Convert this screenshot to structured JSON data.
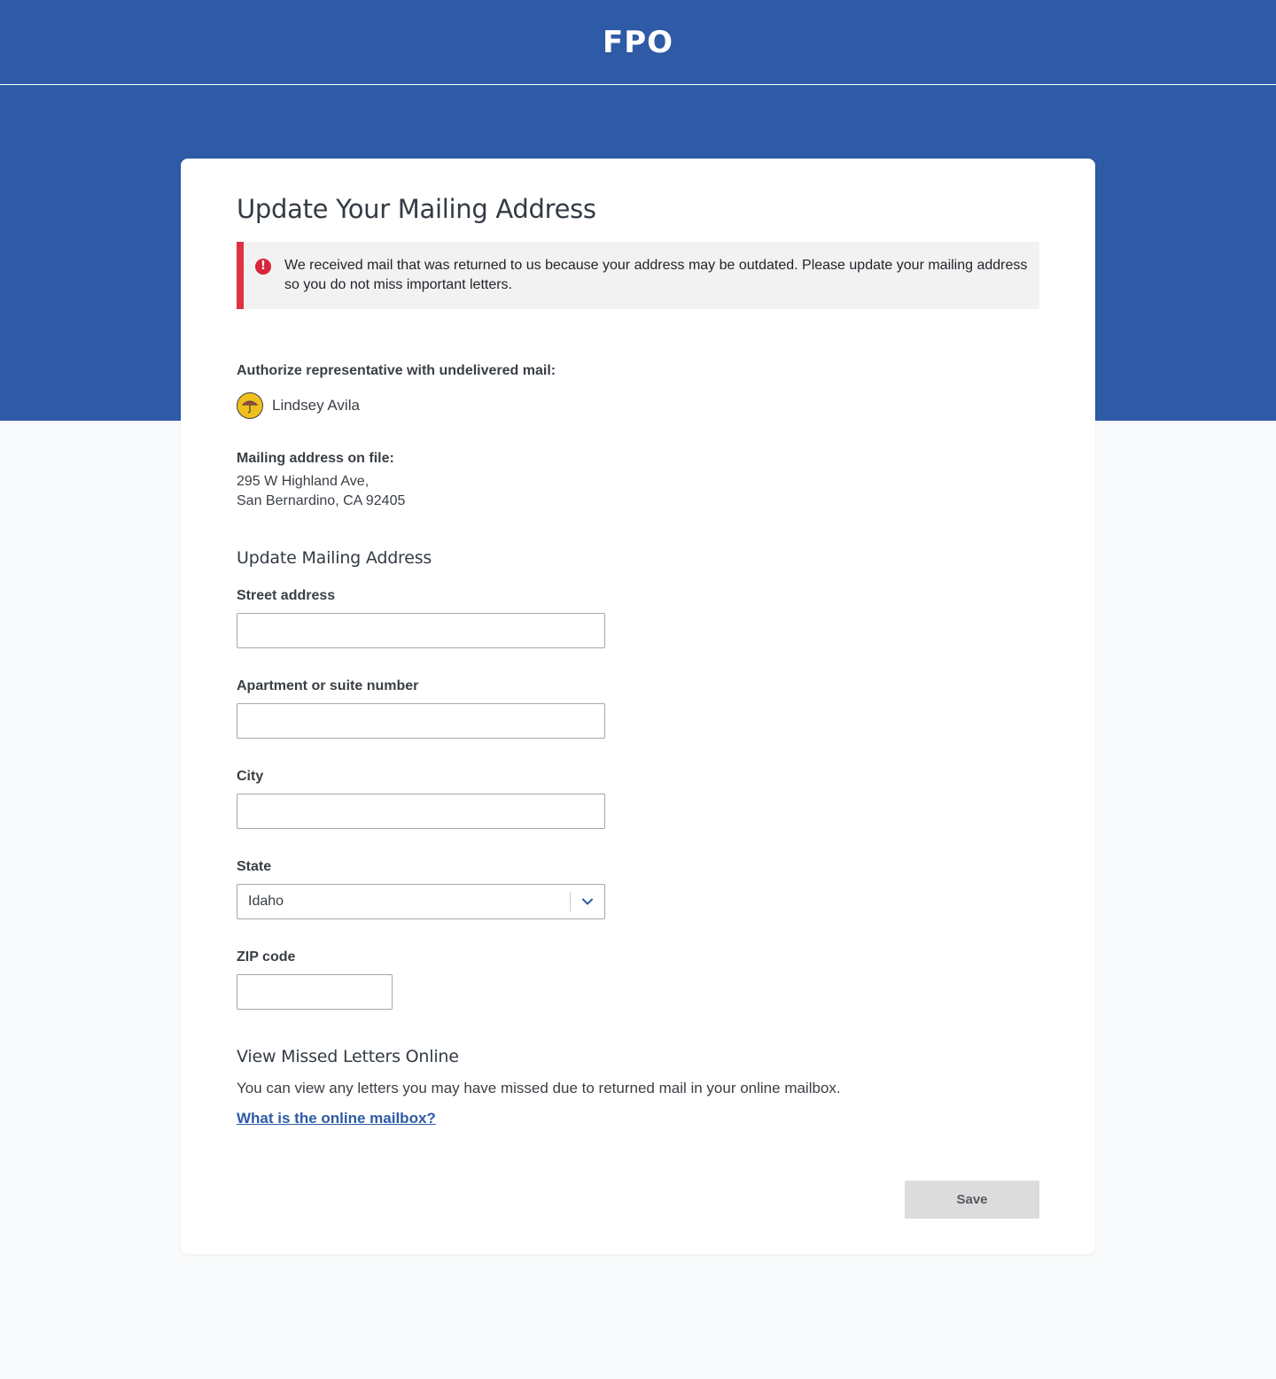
{
  "header": {
    "brand": "FPO"
  },
  "page": {
    "title": "Update Your Mailing Address"
  },
  "alert": {
    "icon": "exclamation-circle-icon",
    "message": "We received mail that was returned to us because your address may be outdated. Please update your mailing address so you do not miss important letters."
  },
  "representative": {
    "label": "Authorize representative with undelivered mail:",
    "name": "Lindsey Avila",
    "avatar_icon": "umbrella-icon"
  },
  "address_on_file": {
    "label": "Mailing address on file:",
    "line1": "295 W Highland Ave,",
    "line2": "San Bernardino, CA 92405"
  },
  "form": {
    "section_title": "Update Mailing Address",
    "street": {
      "label": "Street address",
      "value": ""
    },
    "apartment": {
      "label": "Apartment or suite number",
      "value": ""
    },
    "city": {
      "label": "City",
      "value": ""
    },
    "state": {
      "label": "State",
      "value": "Idaho"
    },
    "zip": {
      "label": "ZIP code",
      "value": ""
    }
  },
  "missed_letters": {
    "title": "View Missed Letters Online",
    "text": "You can view any letters you may have missed due to returned mail in your online mailbox.",
    "link": "What is the online mailbox?"
  },
  "actions": {
    "save_label": "Save"
  },
  "colors": {
    "brand_blue": "#2e5aa6",
    "alert_red": "#e03142",
    "page_bg": "#f9fafb",
    "avatar_yellow": "#f1bf1c",
    "disabled_button": "#dcdcdc"
  }
}
